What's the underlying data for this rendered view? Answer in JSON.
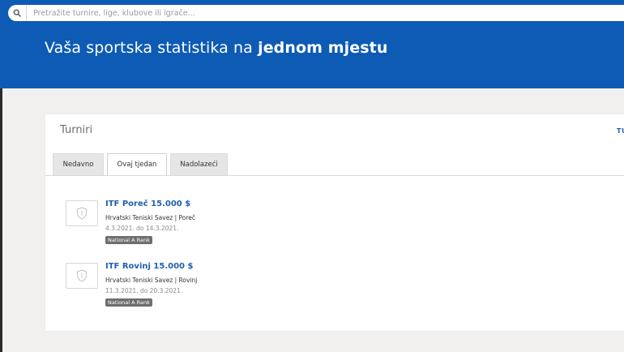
{
  "search": {
    "placeholder": "Pretražite turnire, lige, klubove ili igrače...",
    "icon": "search-icon"
  },
  "hero": {
    "title_regular": "Vaša sportska statistika na ",
    "title_bold": "jednom mjestu"
  },
  "colors": {
    "header_bg": "#0d5bb5",
    "link": "#1f5fb0",
    "badge_bg": "#6e6e6e",
    "page_bg": "#f1f0ee"
  },
  "tournaments": {
    "title": "Turniri",
    "link_label": "TU",
    "tabs": [
      {
        "label": "Nedavno",
        "active": false
      },
      {
        "label": "Ovaj tjedan",
        "active": true
      },
      {
        "label": "Nadolazeći",
        "active": false
      }
    ],
    "items": [
      {
        "name": "ITF Poreč 15.000 $",
        "org": "Hrvatski Teniski Savez | Poreč",
        "dates": "4.3.2021. do 14.3.2021.",
        "badge": "National A Rank",
        "logo_icon": "shield-icon"
      },
      {
        "name": "ITF Rovinj 15.000 $",
        "org": "Hrvatski Teniski Savez | Rovinj",
        "dates": "11.3.2021. do 20.3.2021.",
        "badge": "National A Rank",
        "logo_icon": "shield-icon"
      }
    ]
  }
}
